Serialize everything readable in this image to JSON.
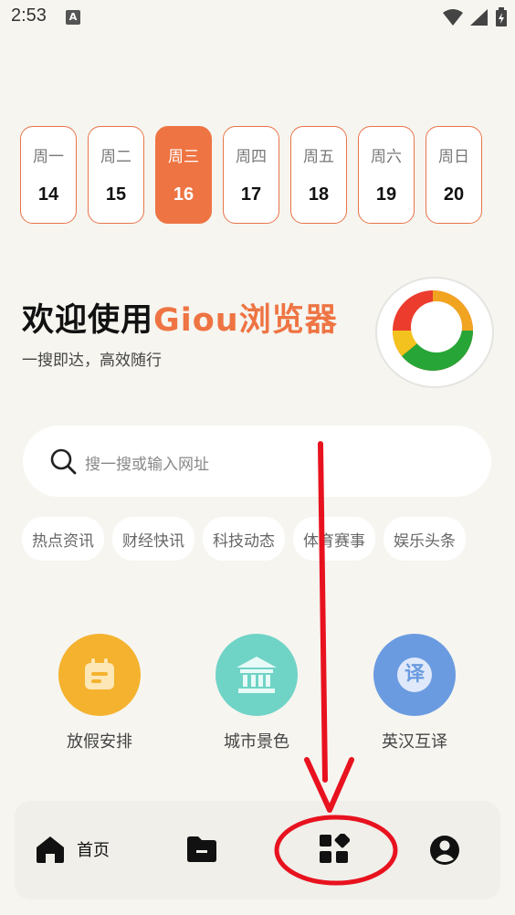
{
  "status_bar": {
    "time": "2:53",
    "notification_letter": "A"
  },
  "week": [
    {
      "name": "周一",
      "date": "14",
      "active": false
    },
    {
      "name": "周二",
      "date": "15",
      "active": false
    },
    {
      "name": "周三",
      "date": "16",
      "active": true
    },
    {
      "name": "周四",
      "date": "17",
      "active": false
    },
    {
      "name": "周五",
      "date": "18",
      "active": false
    },
    {
      "name": "周六",
      "date": "19",
      "active": false
    },
    {
      "name": "周日",
      "date": "20",
      "active": false
    }
  ],
  "welcome": {
    "prefix": "欢迎使用",
    "brand": "Giou浏览器",
    "slogan": "一搜即达，高效随行"
  },
  "search": {
    "placeholder": "搜一搜或输入网址"
  },
  "chips": [
    "热点资讯",
    "财经快讯",
    "科技动态",
    "体育赛事",
    "娱乐头条"
  ],
  "shortcuts": [
    {
      "label": "放假安排",
      "icon": "calendar-icon",
      "color": "#f4b22e"
    },
    {
      "label": "城市景色",
      "icon": "building-icon",
      "color": "#6fd3c6"
    },
    {
      "label": "英汉互译",
      "icon": "translate-icon",
      "color": "#6a9be0",
      "glyph": "译"
    }
  ],
  "bottom_nav": {
    "home_label": "首页"
  },
  "colors": {
    "accent": "#ee7443",
    "background": "#f6f5f0",
    "annotation": "#e8121f"
  }
}
